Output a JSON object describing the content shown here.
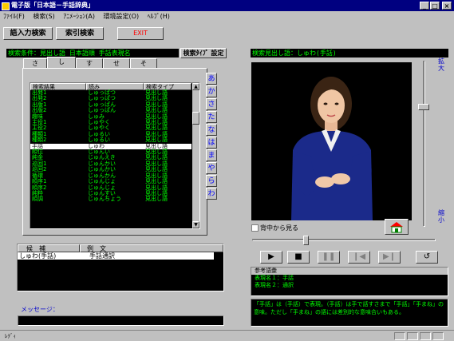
{
  "window": {
    "title": "電子版「日本語－手話辞典」"
  },
  "menu": [
    "ﾌｧｲﾙ(F)",
    "検索(S)",
    "ｱﾆﾒｰｼｮﾝ(A)",
    "環境設定(O)",
    "ﾍﾙﾌﾟ(H)"
  ],
  "toolbar": {
    "tab1": "語入力検索",
    "tab2": "索引検索",
    "exit": "EXIT"
  },
  "search": {
    "condition": "検索条件：見出し語 日本語順 手話表現名",
    "type_button": "検索ﾀｲﾌﾟ 設定"
  },
  "kana_tabs": [
    "さ",
    "し",
    "す",
    "せ",
    "そ"
  ],
  "kana_side": [
    "あ",
    "か",
    "さ",
    "た",
    "な",
    "は",
    "ま",
    "や",
    "ら",
    "わ"
  ],
  "results": {
    "headers": [
      "検索結果",
      "読み",
      "検索タイプ"
    ],
    "rows": [
      [
        "出発1",
        "しゅっぱつ",
        "見出し語"
      ],
      [
        "出発2",
        "しゅっぱつ",
        "見出し語"
      ],
      [
        "出版1",
        "しゅっぱん",
        "見出し語"
      ],
      [
        "出版2",
        "しゅっぱん",
        "見出し語"
      ],
      [
        "趣味",
        "しゅみ",
        "見出し語"
      ],
      [
        "主役1",
        "しゅやく",
        "見出し語"
      ],
      [
        "主役2",
        "しゅやく",
        "見出し語"
      ],
      [
        "種類1",
        "しゅるい",
        "見出し語"
      ],
      [
        "種類2",
        "しゅるい",
        "見出し語"
      ],
      [
        "手話",
        "しゅわ",
        "見出し語"
      ],
      [
        "順位",
        "じゅんい",
        "見出し語"
      ],
      [
        "純金",
        "じゅんえき",
        "見出し語"
      ],
      [
        "巡回1",
        "じゅんかい",
        "見出し語"
      ],
      [
        "巡回2",
        "じゅんかい",
        "見出し語"
      ],
      [
        "循環",
        "じゅんかん",
        "見出し語"
      ],
      [
        "順序1",
        "じゅんじょ",
        "見出し語"
      ],
      [
        "順序2",
        "じゅんじょ",
        "見出し語"
      ],
      [
        "純粋",
        "じゅんすい",
        "見出し語"
      ],
      [
        "順調",
        "じゅんちょう",
        "見出し語"
      ]
    ],
    "selected_index": 9
  },
  "candidates": {
    "headers": [
      "候　補",
      "例　文"
    ],
    "rows": [
      [
        "しゅわ(手話)",
        "手話通訳"
      ]
    ]
  },
  "message": {
    "label": "メッセージ："
  },
  "viewer": {
    "heading": "検索見出し語：しゅわ(手話)",
    "zoom_in": "拡大",
    "zoom_out": "縮小",
    "back_view_label": "背中から見る"
  },
  "reference": {
    "heading": "参考語彙",
    "lines": [
      "表現名１：手話",
      "表現名２：通訳"
    ]
  },
  "description": "「手話」は（手話）で表現。（手話）は手で話すさまで「手話」「手まね」の意味。ただし「手まね」の語には差別的な意味合いもある。",
  "status": {
    "text": "ﾚﾃﾞｨ"
  },
  "colors": {
    "title_bar": "#000080",
    "panel": "#c0c0c0",
    "display_bg": "#000000",
    "display_text": "#00ff00",
    "accent_red": "#ff0000"
  }
}
